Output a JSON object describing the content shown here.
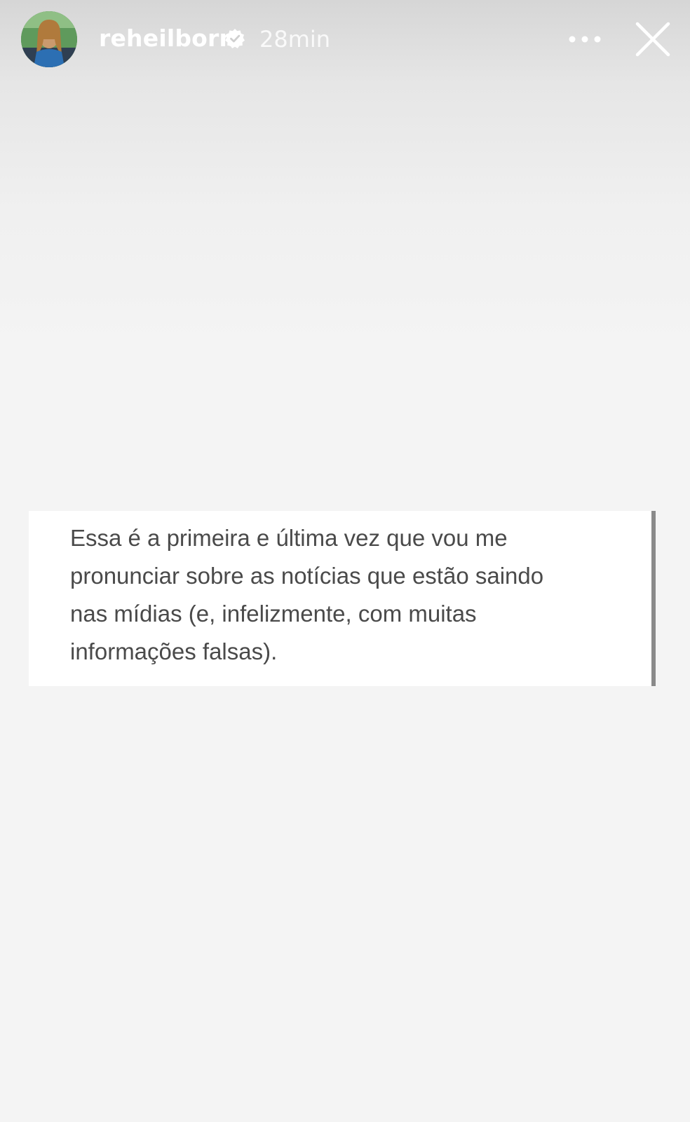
{
  "header": {
    "avatar_icon": "profile-avatar",
    "username": "reheilborn",
    "verified_icon": "verified-badge-icon",
    "timestamp": "28min",
    "more_icon": "more-horizontal-icon",
    "close_icon": "close-icon"
  },
  "story": {
    "card_lines": [
      "Essa é a primeira e última vez que vou me",
      "pronunciar sobre as notícias que estão saindo",
      "nas mídias (e, infelizmente, com muitas",
      "informações falsas)."
    ]
  }
}
